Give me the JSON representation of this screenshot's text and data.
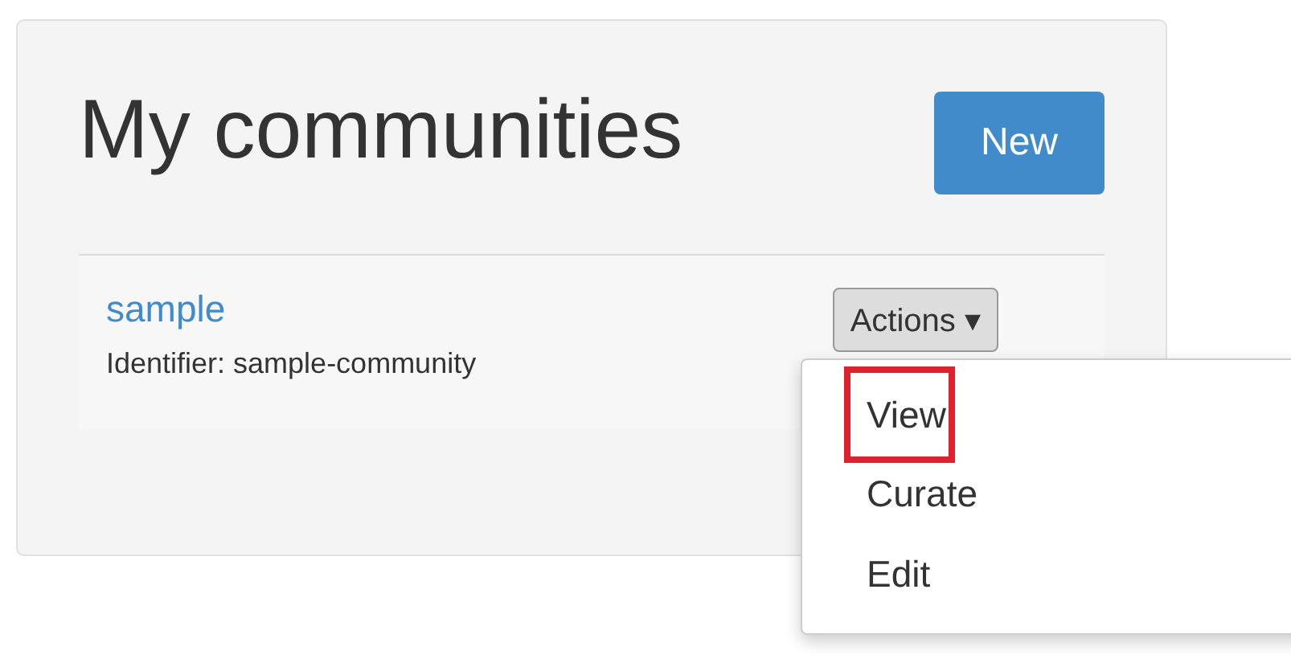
{
  "panel": {
    "title": "My communities",
    "new_button": "New"
  },
  "communities": [
    {
      "name": "sample",
      "identifier": "Identifier: sample-community",
      "actions_button": "Actions",
      "caret": "▾"
    }
  ],
  "actions_menu": {
    "items": [
      {
        "label": "View",
        "highlighted": true
      },
      {
        "label": "Curate",
        "highlighted": false
      },
      {
        "label": "Edit",
        "highlighted": false
      }
    ]
  }
}
